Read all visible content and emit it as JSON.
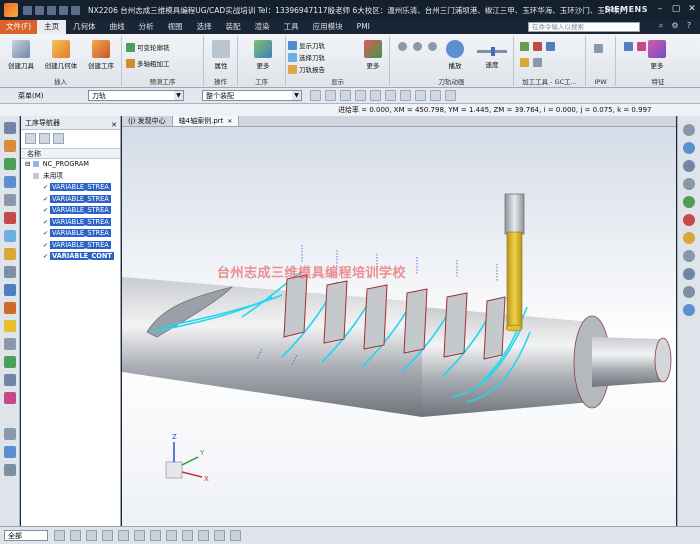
{
  "titlebar": {
    "title": "NX2206 台州志成三维模具编程UG/CAD实战培训  Tel：13396947117殷老师 6大校区：温州乐清、台州三门浦坝港、椒江三甲、玉环华海、玉环沙门、玉环坎门 - 加工",
    "brand": "SIEMENS",
    "minimize": "–",
    "maximize": "▢",
    "close": "✕"
  },
  "menu": {
    "file": "文件(F)",
    "tabs": [
      "主页",
      "几何体",
      "曲线",
      "分析",
      "视图",
      "选择",
      "装配",
      "渲染",
      "工具",
      "应用模块",
      "PMI"
    ],
    "active_tab": "主页",
    "search_placeholder": "在命令输入以搜索"
  },
  "ribbon": {
    "insert_group": {
      "label": "插入",
      "buttons": [
        "创建刀具",
        "创建几何体",
        "创建工序"
      ]
    },
    "predefined_group": {
      "label": "预测工序",
      "items": [
        "可变轮廓铣",
        "多轴粗加工"
      ]
    },
    "operation_group": {
      "label": "操作",
      "button": "属性"
    },
    "process_group": {
      "label": "工序",
      "button": "更多"
    },
    "display_group": {
      "label": "显示",
      "items": [
        "显示刀轨",
        "选择刀轨",
        "刀轨报告"
      ],
      "more": "更多"
    },
    "toolpath_anim_group": {
      "label": "刀轨动画",
      "buttons": [
        "播放",
        "速度"
      ]
    },
    "machining_tools_group": {
      "label": "加工工具 - GC工..."
    },
    "ipw_group": {
      "label": "IPW"
    },
    "features_group": {
      "label": "特征",
      "button": "更多"
    }
  },
  "toolbar2": {
    "menu_label": "菜单(M)",
    "filter_value": "刀轨",
    "scope_value": "整个装配"
  },
  "status": {
    "coords": "进给率 = 0.000, XM = 450.798, YM = 1.445, ZM = 39.764, i = 0.000, j = 0.075, k = 0.997"
  },
  "navigator": {
    "title": "工序导航器",
    "column_header": "名称",
    "root": "NC_PROGRAM",
    "unused": "未用项",
    "operations": [
      "VARIABLE_STREA",
      "VARIABLE_STREA",
      "VARIABLE_STREA",
      "VARIABLE_STREA",
      "VARIABLE_STREA",
      "VARIABLE_STREA",
      "VARIABLE_CONT"
    ]
  },
  "doc_tabs": [
    "(j) 发现中心",
    "轴4轴案例.prt"
  ],
  "viewport": {
    "watermark": "台州志成三维模具编程培训学校",
    "axis_labels": [
      "Z",
      "Y",
      "X"
    ]
  },
  "bottom": {
    "selection_filter": "全部"
  },
  "colors": {
    "title_bg": "#15202f",
    "file_tab": "#d9632a",
    "selection_blue": "#2b63c7",
    "toolpath_cyan": "#22d6ef",
    "tool_yellow": "#e2c12a"
  }
}
